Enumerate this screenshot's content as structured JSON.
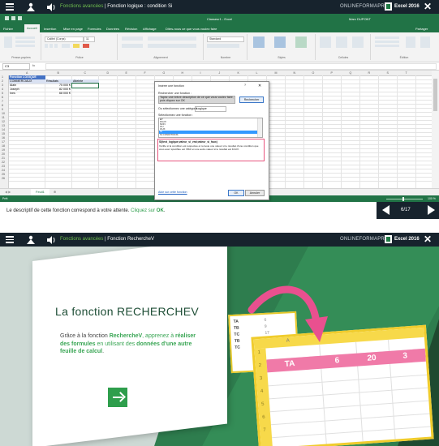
{
  "panel1": {
    "appbar": {
      "section": "Fonctions avancées",
      "separator": " | ",
      "lesson": "Fonction logique : condition Si",
      "brand": "ONLINEFORMAPRO",
      "product": "Excel 2016"
    },
    "excel": {
      "window_title": "Classeur1 - Excel",
      "user": "Marc DUPONT",
      "tabs": [
        "Fichier",
        "Accueil",
        "Insertion",
        "Mise en page",
        "Formules",
        "Données",
        "Révision",
        "Affichage",
        "Dites-nous ce que vous voulez faire"
      ],
      "share": "Partager",
      "ribbon_groups": [
        "Presse-papiers",
        "Police",
        "Alignement",
        "Nombre",
        "Styles",
        "Cellules",
        "Édition"
      ],
      "font_name": "Calibri (Corps)",
      "font_size": "11",
      "number_format": "Standard",
      "namebox": "C3",
      "formula": "",
      "columns": [
        "A",
        "B",
        "C",
        "D",
        "E",
        "F",
        "G",
        "H",
        "I",
        "J",
        "K",
        "L",
        "M",
        "N",
        "O",
        "P",
        "Q",
        "R",
        "S",
        "T"
      ],
      "rows": [
        "1",
        "2",
        "3",
        "4",
        "5",
        "6",
        "7",
        "8",
        "9",
        "10",
        "11",
        "12",
        "13",
        "14",
        "15",
        "16",
        "17",
        "18",
        "19",
        "20",
        "21",
        "22",
        "23",
        "24",
        "25",
        "26"
      ],
      "table_title": "Fonction LOGIQUE",
      "table_headers": [
        "COMMERCIAUX",
        "Résultats",
        "Atteinte"
      ],
      "table_rows": [
        [
          "Alain",
          "75 000 €",
          ""
        ],
        [
          "Joseph",
          "82 000 €",
          ""
        ],
        [
          "Ines",
          "68 000 €",
          ""
        ]
      ],
      "sheet_tab": "Feuil1",
      "status_mode": "Prêt",
      "zoom": "100 %"
    },
    "dialog": {
      "title": "Insérer une fonction",
      "help": "?",
      "search_label": "Rechercher une fonction :",
      "search_text": "Tapez une brève description de ce que vous voulez faire, puis cliquez sur OK",
      "search_button": "Rechercher",
      "category_label": "Ou sélectionnez une catégorie :",
      "category_value": "Logique",
      "list_label": "Sélectionnez une fonction :",
      "functions": [
        "ET",
        "FAUX",
        "NON",
        "OU",
        "OUX",
        "SI",
        "SI.CONDITIONS"
      ],
      "selected_function": "SI",
      "signature": "SI(test_logique;valeur_si_vrai;valeur_si_faux)",
      "description": "Vérifie si la condition est respectée et renvoie une valeur si le résultat d'une condition que vous avez spécifiée est VRAI et une autre valeur si le résultat est FAUX.",
      "help_link": "Aide sur cette fonction",
      "ok": "OK",
      "cancel": "Annuler"
    },
    "instruction": {
      "text": "Le descriptif de cette fonction correspond à votre attente.",
      "action_prefix": "Cliquez sur",
      "action_target": "OK",
      "end": "."
    },
    "nav": {
      "counter": "6/17"
    }
  },
  "panel2": {
    "appbar": {
      "section": "Fonctions avancées",
      "separator": " | ",
      "lesson": "Fonction RechercheV",
      "brand": "ONLINEFORMAPRO",
      "product": "Excel 2016"
    },
    "card": {
      "title": "La fonction RECHERCHEV",
      "body_parts": [
        "Grâce à la fonction ",
        "RechercheV",
        ", apprenez à ",
        "réaliser des formules",
        " en utilisant des ",
        "données d'une autre feuille de calcul",
        "."
      ]
    },
    "small_sheet": {
      "rows": [
        "TA",
        "TB",
        "TC",
        "TB",
        "TC"
      ],
      "values": [
        "6",
        "9",
        "17",
        "6",
        "12"
      ]
    },
    "big_sheet": {
      "col_label": "A",
      "row_numbers": [
        "1",
        "2",
        "3",
        "4",
        "5",
        "6",
        "7"
      ],
      "highlight": [
        "TA",
        "6",
        "20",
        "3"
      ]
    }
  },
  "colors": {
    "appbar": "#17232d",
    "excel_green": "#217346",
    "accent_green": "#2e9e4c",
    "pink": "#f07aa8",
    "yellow": "#f0cc2c"
  }
}
